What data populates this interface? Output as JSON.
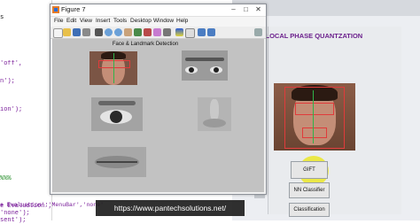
{
  "editor": {
    "lines": [
      {
        "text": "s",
        "cls": "k"
      },
      {
        "text": "'off',",
        "cls": ""
      },
      {
        "text": "n');",
        "cls": ""
      },
      {
        "text": "ion');",
        "cls": ""
      },
      {
        "text": "%%%",
        "cls": "g"
      },
      {
        "text": "e Evaluation','MenuBar','none'",
        "cls": ""
      },
      {
        "text": "'none');",
        "cls": ""
      },
      {
        "text": "sent');",
        "cls": ""
      }
    ]
  },
  "gui": {
    "title": "D LOCAL PHASE QUANTZATION",
    "buttons": {
      "gift": "GIFT",
      "nn_classifier": "NN Classifier",
      "classification": "Classification"
    }
  },
  "figure": {
    "title": "Figure 7",
    "menu": [
      "File",
      "Edit",
      "View",
      "Insert",
      "Tools",
      "Desktop",
      "Window",
      "Help"
    ],
    "plot_title": "Face & Landmark Detection",
    "title_controls": {
      "min": "–",
      "max": "□",
      "close": "✕"
    }
  },
  "footer_url": "https://www.pantechsolutions.net/",
  "colors": {
    "gui_title": "#6b1f8c",
    "detect_box": "#e03b3b",
    "landmark_line": "#2fb34a",
    "highlight": "#ebe828"
  },
  "icons": {
    "figure_window": "figure-app-icon",
    "toolbar": [
      "new-file-icon",
      "open-icon",
      "save-icon",
      "print-icon",
      "pointer-icon",
      "zoom-in-icon",
      "zoom-out-icon",
      "pan-icon",
      "rotate-icon",
      "data-cursor-icon",
      "brush-icon",
      "link-icon",
      "colorbar-icon",
      "legend-icon",
      "hide-icon",
      "show-icon",
      "dock-icon"
    ]
  }
}
